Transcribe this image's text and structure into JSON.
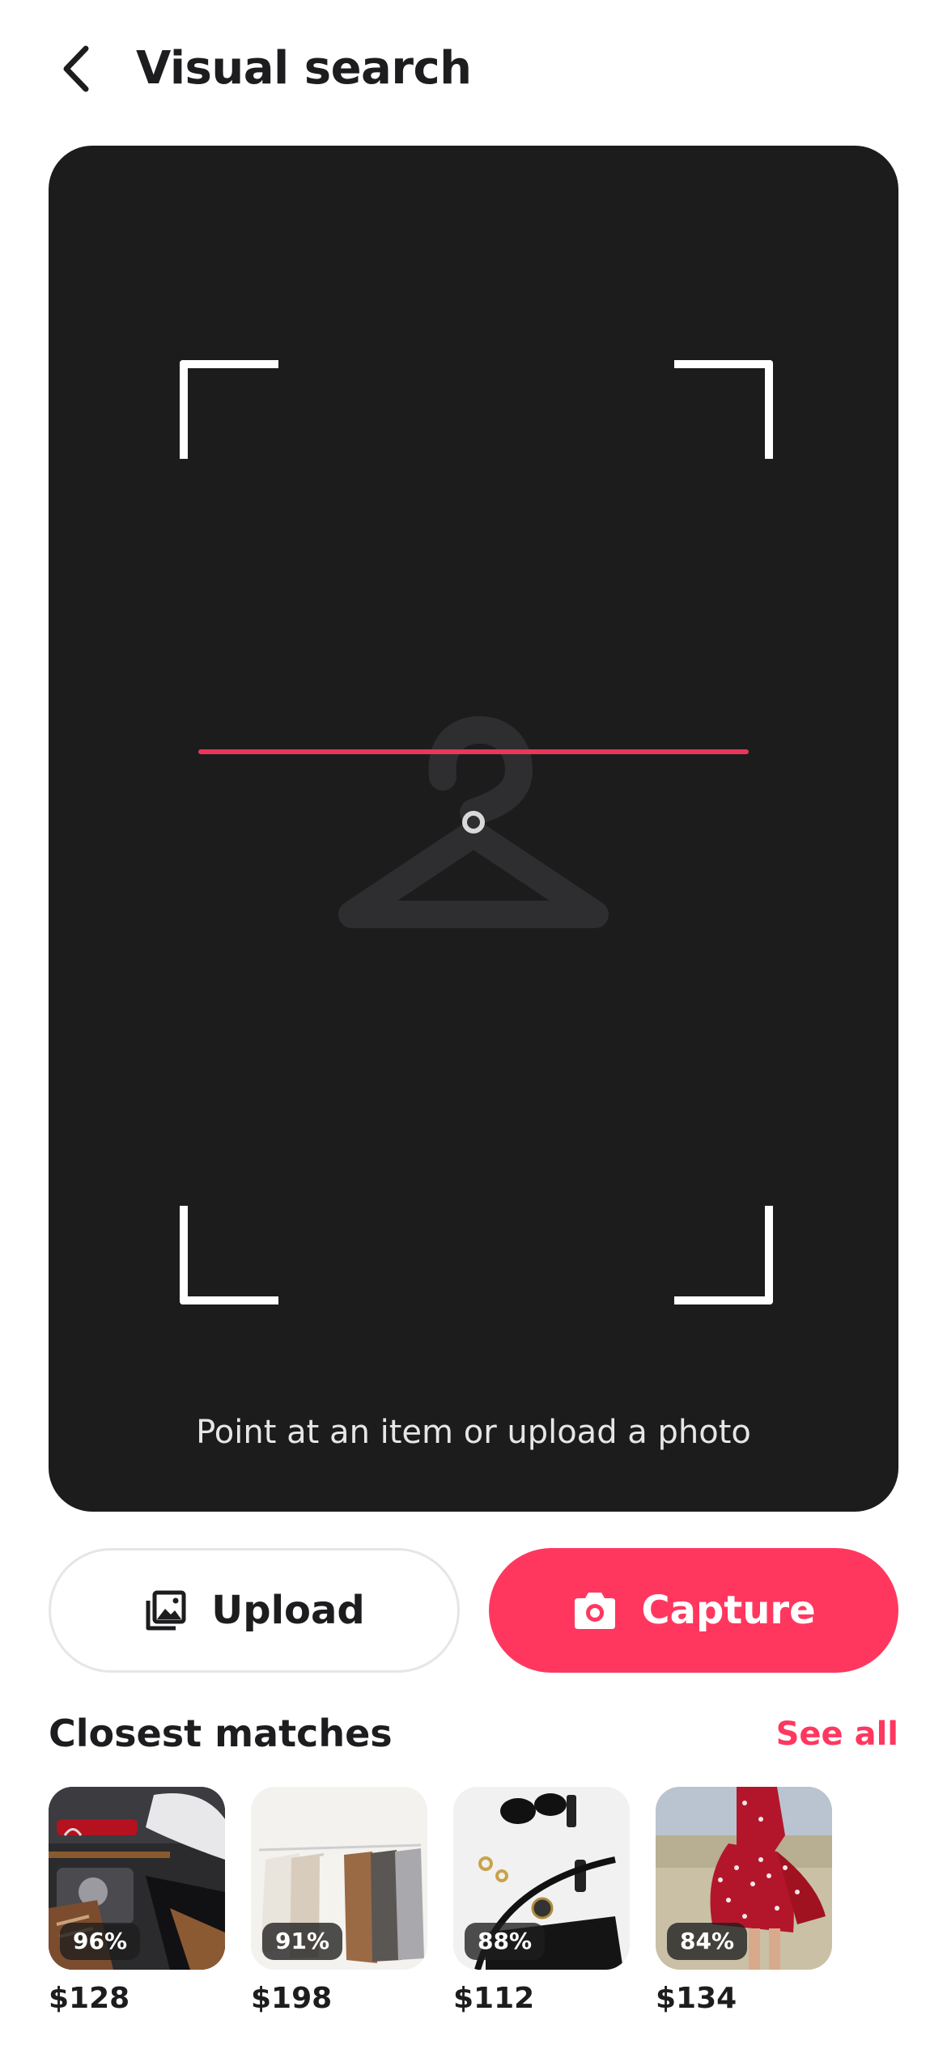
{
  "header": {
    "title": "Visual search",
    "back_icon": "chevron-left-icon"
  },
  "viewfinder": {
    "hint": "Point at an item or upload a photo",
    "placeholder_icon": "hanger-icon",
    "scan_line_color": "#e8375a"
  },
  "actions": {
    "upload_label": "Upload",
    "upload_icon": "image-gallery-icon",
    "capture_label": "Capture",
    "capture_icon": "camera-icon",
    "accent": "#ff375f"
  },
  "matches": {
    "title": "Closest matches",
    "see_all": "See all",
    "items": [
      {
        "match": "96%",
        "price": "$128",
        "image": "closet-items-photo"
      },
      {
        "match": "91%",
        "price": "$198",
        "image": "clothing-rack-photo"
      },
      {
        "match": "88%",
        "price": "$112",
        "image": "accessories-flatlay-photo"
      },
      {
        "match": "84%",
        "price": "$134",
        "image": "red-polka-dot-dress-photo"
      }
    ]
  }
}
